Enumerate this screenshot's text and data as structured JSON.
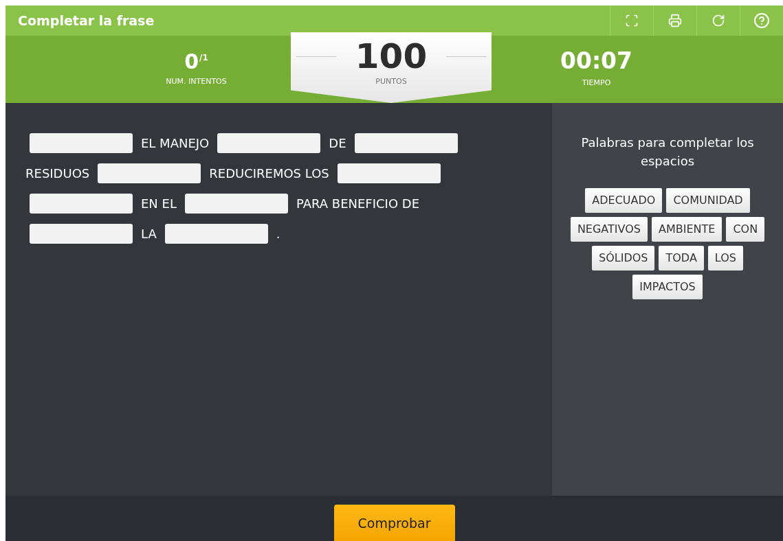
{
  "title": "Completar la frase",
  "toolbar": [
    {
      "kind": "screen"
    },
    {
      "kind": "print"
    },
    {
      "kind": "reload"
    },
    {
      "kind": "help"
    }
  ],
  "stats": {
    "attempts": {
      "value": "0",
      "total": "/1",
      "label": "NUM. INTENTOS"
    },
    "score": {
      "value": "100",
      "label": "PUNTOS"
    },
    "time": {
      "value": "00:07",
      "label": "TIEMPO"
    }
  },
  "sentence": [
    [
      {
        "kind": "blank"
      },
      {
        "kind": "text",
        "text": "EL MANEJO"
      },
      {
        "kind": "blank"
      },
      {
        "kind": "text",
        "text": "DE"
      },
      {
        "kind": "blank"
      }
    ],
    [
      {
        "kind": "text",
        "text": "RESIDUOS"
      },
      {
        "kind": "blank"
      },
      {
        "kind": "text",
        "text": "REDUCIREMOS LOS"
      },
      {
        "kind": "blank"
      }
    ],
    [
      {
        "kind": "blank"
      },
      {
        "kind": "text",
        "text": "EN EL"
      },
      {
        "kind": "blank"
      },
      {
        "kind": "text",
        "text": "PARA BENEFICIO DE"
      }
    ],
    [
      {
        "kind": "blank"
      },
      {
        "kind": "text",
        "text": "LA"
      },
      {
        "kind": "blank"
      },
      {
        "kind": "text",
        "text": "."
      }
    ]
  ],
  "word_bank": {
    "title": "Palabras para completar los espacios",
    "rows": [
      [
        "ADECUADO",
        "COMUNIDAD"
      ],
      [
        "NEGATIVOS",
        "AMBIENTE",
        "CON"
      ],
      [
        "SÓLIDOS",
        "TODA",
        "LOS"
      ],
      [
        "IMPACTOS"
      ]
    ]
  },
  "check_button": "Comprobar"
}
